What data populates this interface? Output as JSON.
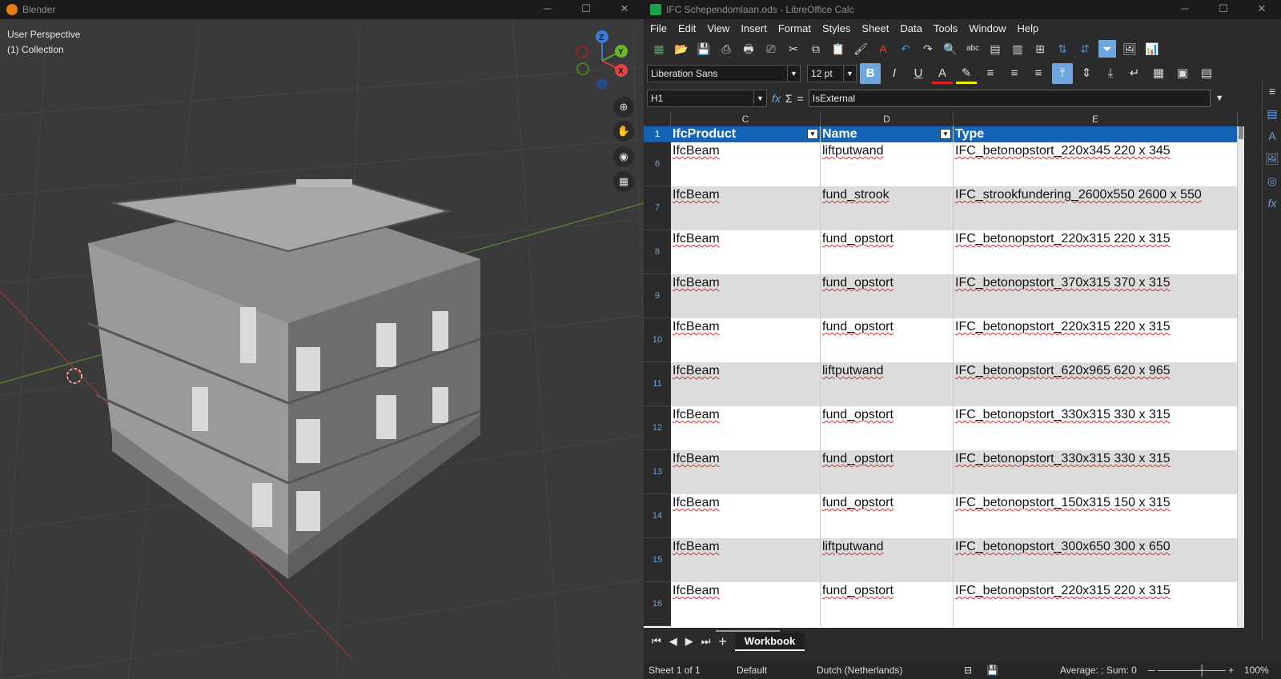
{
  "blender": {
    "title": "Blender",
    "view_name": "User Perspective",
    "collection": "(1) Collection",
    "axes": {
      "z": "Z",
      "y": "Y",
      "x": "X"
    },
    "tools": [
      "zoom-icon",
      "hand-icon",
      "camera-icon",
      "grid-icon"
    ]
  },
  "calc": {
    "title": "IFC Schependomlaan.ods - LibreOffice Calc",
    "menu": [
      "File",
      "Edit",
      "View",
      "Insert",
      "Format",
      "Styles",
      "Sheet",
      "Data",
      "Tools",
      "Window",
      "Help"
    ],
    "font_name": "Liberation Sans",
    "font_size": "12 pt",
    "bold": "B",
    "italic": "I",
    "underline": "U",
    "font_color_glyph": "A",
    "cell_ref": "H1",
    "fx": "fx",
    "sigma": "Σ",
    "equals": "=",
    "formula": "IsExternal",
    "columns": [
      "C",
      "D",
      "E"
    ],
    "header_row": {
      "num": "1",
      "c": "IfcProduct",
      "d": "Name",
      "e": "Type"
    },
    "rows": [
      {
        "num": "6",
        "c": "IfcBeam",
        "d": "liftputwand",
        "e": "IFC_betonopstort_220x345 220 x 345"
      },
      {
        "num": "7",
        "c": "IfcBeam",
        "d": "fund_strook",
        "e": "IFC_strookfundering_2600x550 2600 x 550"
      },
      {
        "num": "8",
        "c": "IfcBeam",
        "d": "fund_opstort",
        "e": "IFC_betonopstort_220x315 220 x 315"
      },
      {
        "num": "9",
        "c": "IfcBeam",
        "d": "fund_opstort",
        "e": "IFC_betonopstort_370x315 370 x 315"
      },
      {
        "num": "10",
        "c": "IfcBeam",
        "d": "fund_opstort",
        "e": "IFC_betonopstort_220x315 220 x 315"
      },
      {
        "num": "11",
        "c": "IfcBeam",
        "d": "liftputwand",
        "e": "IFC_betonopstort_620x965 620 x 965"
      },
      {
        "num": "12",
        "c": "IfcBeam",
        "d": "fund_opstort",
        "e": "IFC_betonopstort_330x315 330 x 315"
      },
      {
        "num": "13",
        "c": "IfcBeam",
        "d": "fund_opstort",
        "e": "IFC_betonopstort_330x315 330 x 315"
      },
      {
        "num": "14",
        "c": "IfcBeam",
        "d": "fund_opstort",
        "e": "IFC_betonopstort_150x315 150 x 315"
      },
      {
        "num": "15",
        "c": "IfcBeam",
        "d": "liftputwand",
        "e": "IFC_betonopstort_300x650 300 x 650"
      },
      {
        "num": "16",
        "c": "IfcBeam",
        "d": "fund_opstort",
        "e": "IFC_betonopstort_220x315 220 x 315"
      }
    ],
    "sheet_tab": "Workbook",
    "status": {
      "sheet": "Sheet 1 of 1",
      "style": "Default",
      "language": "Dutch (Netherlands)",
      "summary": "Average: ; Sum: 0",
      "zoom": "100%"
    },
    "colors": {
      "header_fill": "#1565b7",
      "alt_row": "#dcdcdc"
    }
  }
}
